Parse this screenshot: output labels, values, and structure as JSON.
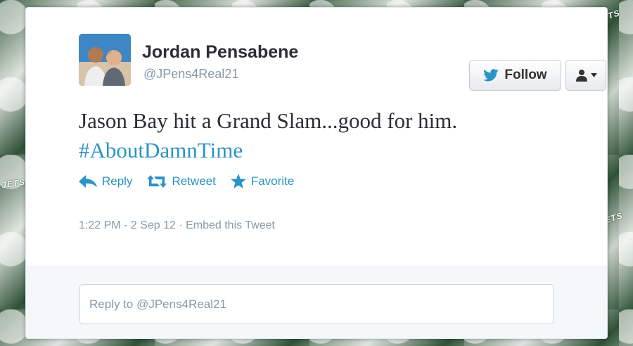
{
  "background": {
    "brand_text": "JETS"
  },
  "tweet": {
    "author": {
      "name": "Jordan Pensabene",
      "handle": "@JPens4Real21",
      "avatar_icon": "profile-photo"
    },
    "text": "Jason Bay hit a Grand Slam...good for him.",
    "hashtag": "#AboutDamnTime",
    "actions": {
      "reply": "Reply",
      "retweet": "Retweet",
      "favorite": "Favorite"
    },
    "timestamp": "1:22 PM - 2 Sep 12",
    "separator": "·",
    "embed_label": "Embed this Tweet"
  },
  "header_buttons": {
    "follow_label": "Follow",
    "follow_icon": "twitter-bird-icon",
    "user_menu_icon": "person-icon"
  },
  "reply": {
    "placeholder": "Reply to @JPens4Real21"
  },
  "colors": {
    "link": "#2a93c7",
    "name": "#292f33",
    "muted": "#8899a6",
    "background_green": "#2c4a33"
  }
}
